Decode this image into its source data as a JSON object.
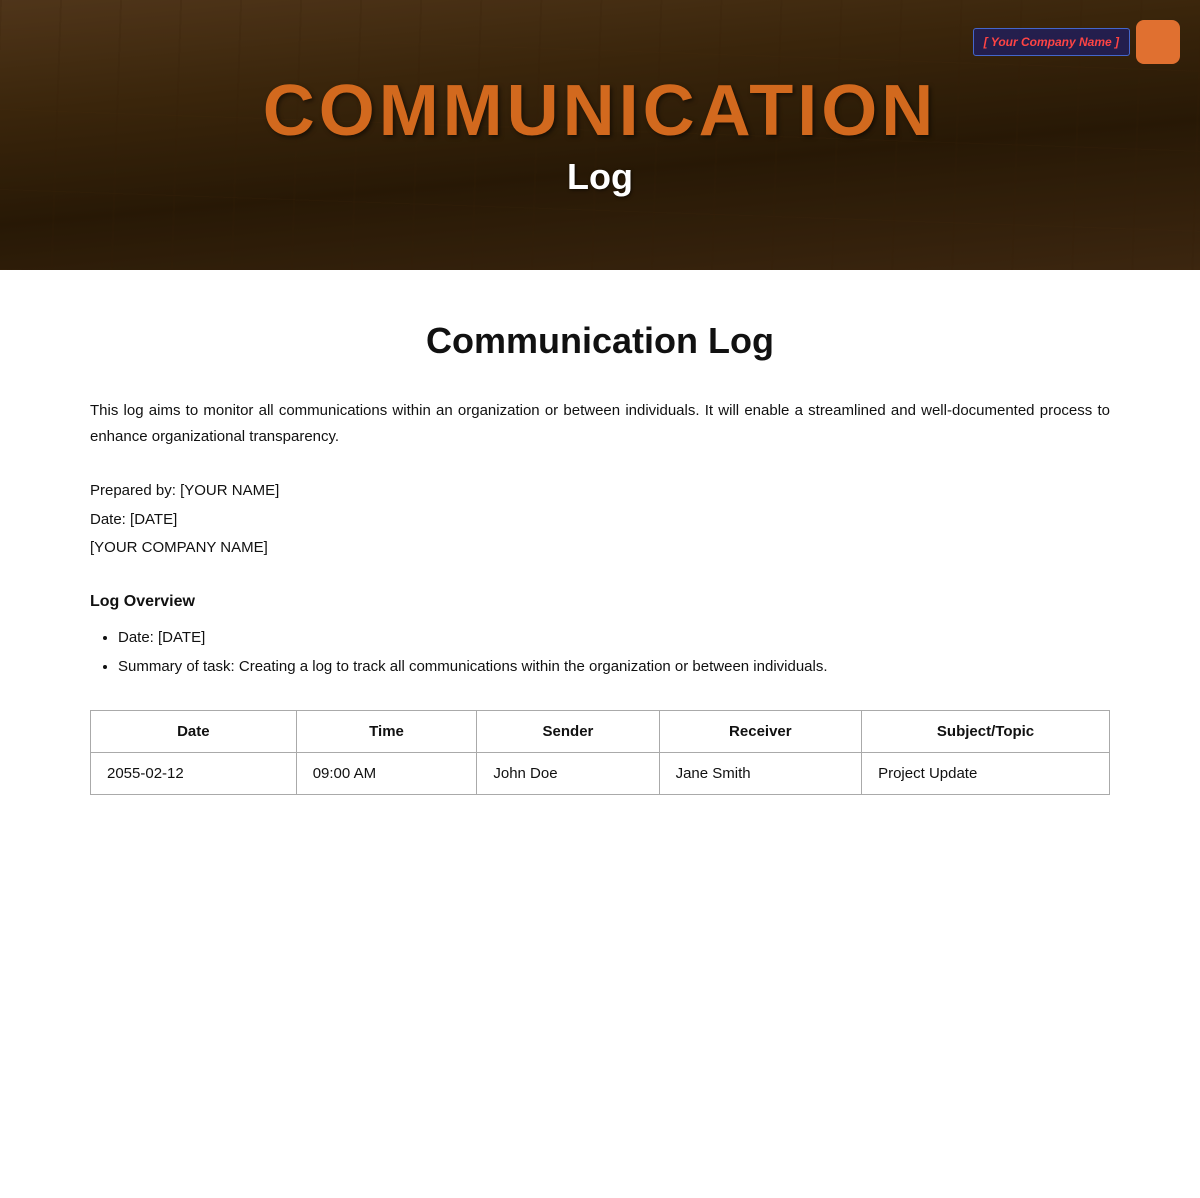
{
  "hero": {
    "title_main": "COMMUNICATION",
    "title_sub": "Log",
    "company_name": "[ Your Company Name ]",
    "company_logo_alt": "company-logo"
  },
  "document": {
    "title": "Communication Log",
    "intro": "This log aims to monitor all communications within an organization or between individuals. It will enable a streamlined and well-documented process to enhance organizational transparency.",
    "prepared_by_label": "Prepared by:",
    "prepared_by_value": "[YOUR NAME]",
    "date_label": "Date:",
    "date_value": "[DATE]",
    "company_placeholder": "[YOUR COMPANY NAME]",
    "section_heading": "Log Overview",
    "overview_items": [
      "Date: [DATE]",
      "Summary of task: Creating a log to track all communications within the organization or between individuals."
    ]
  },
  "table": {
    "headers": [
      "Date",
      "Time",
      "Sender",
      "Receiver",
      "Subject/Topic"
    ],
    "rows": [
      {
        "date": "2055-02-12",
        "time": "09:00 AM",
        "sender": "John Doe",
        "receiver": "Jane Smith",
        "subject": "Project Update"
      }
    ]
  }
}
